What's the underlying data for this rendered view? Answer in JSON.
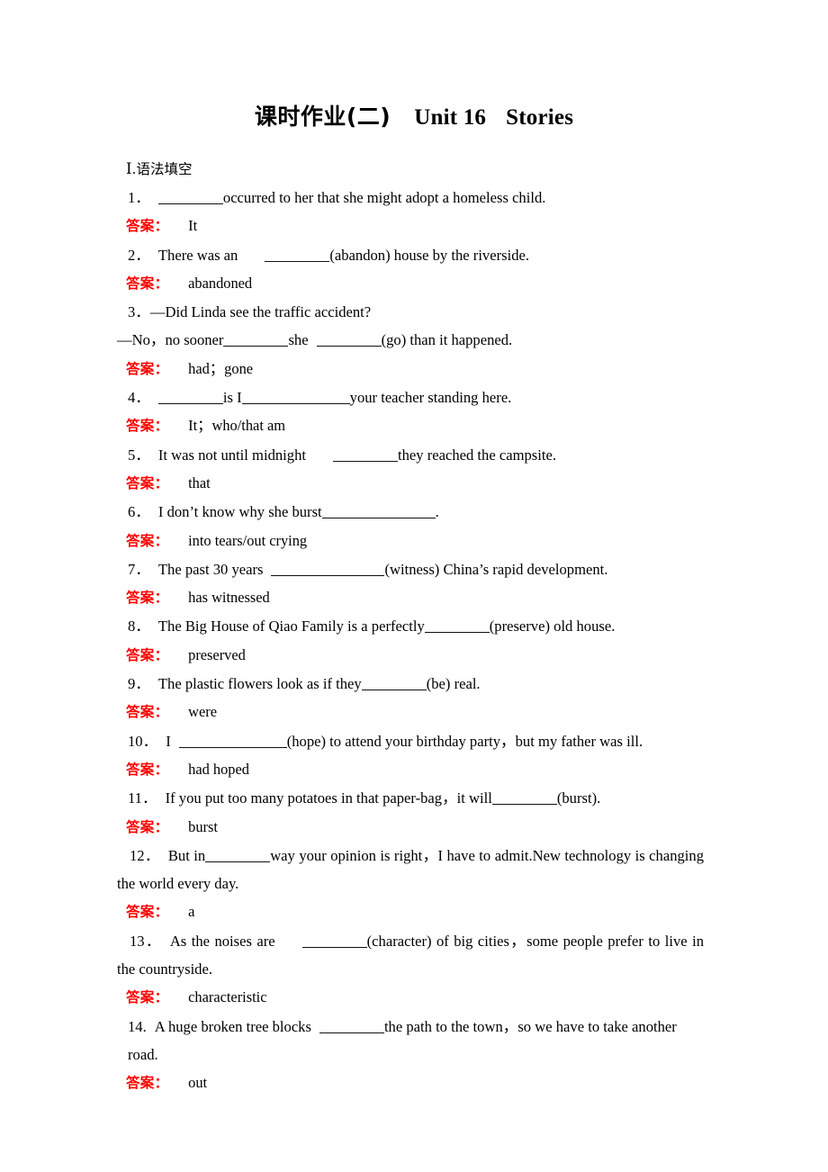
{
  "document": {
    "title_cn": "课时作业(二)",
    "title_unit": "Unit 16",
    "title_topic": "Stories",
    "section_number": "Ⅰ",
    "section_label": ".语法填空",
    "answer_label": "答案",
    "answer_colon": "："
  },
  "items": [
    {
      "number": "1．",
      "q_before": "",
      "q_after": "occurred to her that she might adopt a homeless child.",
      "answer": "It"
    },
    {
      "number": "2．",
      "q_before": "There was an",
      "q_after": "(abandon) house by the riverside.",
      "answer": "abandoned"
    },
    {
      "number": "3．",
      "q_line1": "—Did Linda see the traffic accident?",
      "q_line2_a": "—No，no sooner",
      "q_line2_b": "she",
      "q_line2_c": "(go) than it happened.",
      "answer": "had；gone"
    },
    {
      "number": "4．",
      "q_before": "",
      "q_mid": "is I",
      "q_after": "your teacher standing here.",
      "answer": "It；who/that am"
    },
    {
      "number": "5．",
      "q_before": "It was not until midnight",
      "q_after": "they reached the campsite.",
      "answer": "that"
    },
    {
      "number": "6．",
      "q_before": "I don’t know why she burst",
      "q_after": ".",
      "answer": "into tears/out crying"
    },
    {
      "number": "7．",
      "q_before": "The past 30 years",
      "q_after": "(witness) China’s rapid development.",
      "answer": "has witnessed"
    },
    {
      "number": "8．",
      "q_before": "The Big House of Qiao Family is a perfectly",
      "q_after": "(preserve) old house.",
      "answer": "preserved"
    },
    {
      "number": "9．",
      "q_before": "The plastic flowers look as if they",
      "q_after": "(be) real.",
      "answer": "were"
    },
    {
      "number": "10．",
      "q_before": "I",
      "q_after": "(hope) to attend your birthday party，but my father was ill.",
      "answer": "had hoped"
    },
    {
      "number": "11．",
      "q_before": "If you put too many potatoes in that paper-bag，it will",
      "q_after": "(burst).",
      "answer": "burst"
    },
    {
      "number": "12．",
      "q_before": "But in",
      "q_after": "way your opinion is right，I have to admit.New technology is changing the world every day.",
      "answer": "a"
    },
    {
      "number": "13．",
      "q_before": "As the noises are",
      "q_after": "(character) of big cities，some people prefer to live in the countryside.",
      "answer": "characteristic"
    },
    {
      "number": "14.",
      "q_before": "A huge broken tree blocks",
      "q_after": "the path to the town，so we have to take another road.",
      "answer": "out"
    }
  ]
}
